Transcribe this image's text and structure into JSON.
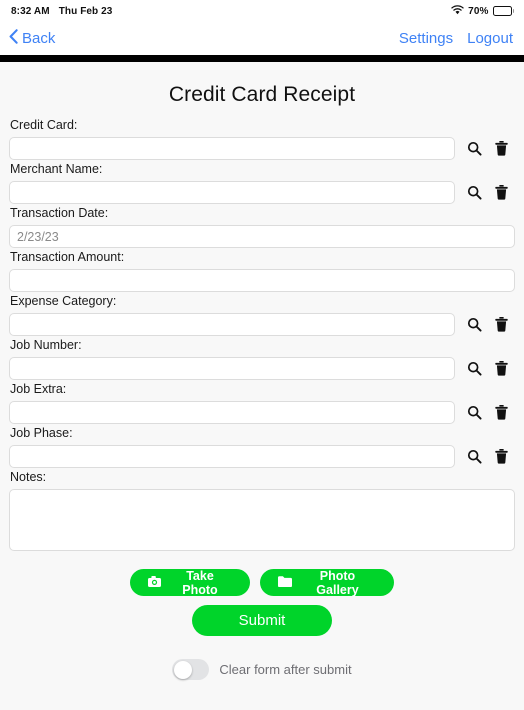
{
  "statusbar": {
    "time": "8:32 AM",
    "date": "Thu Feb 23",
    "battery_percent": "70%",
    "wifi_icon": "wifi-icon",
    "battery_icon": "battery-icon"
  },
  "navbar": {
    "back_label": "Back",
    "back_icon": "chevron-left-icon",
    "settings_label": "Settings",
    "logout_label": "Logout",
    "link_color": "#3f82f5"
  },
  "page": {
    "title": "Credit Card Receipt",
    "background": "#f8f8f8",
    "accent_green": "#00d42a"
  },
  "fields": [
    {
      "label": "Credit Card:",
      "value": "",
      "placeholder": "",
      "has_icons": true,
      "search_icon": "search-icon",
      "trash_icon": "trash-icon"
    },
    {
      "label": "Merchant Name:",
      "value": "",
      "placeholder": "",
      "has_icons": true,
      "search_icon": "search-icon",
      "trash_icon": "trash-icon"
    },
    {
      "label": "Transaction Date:",
      "value": "2/23/23",
      "placeholder": "",
      "has_icons": false
    },
    {
      "label": "Transaction Amount:",
      "value": "",
      "placeholder": "",
      "has_icons": false
    },
    {
      "label": "Expense Category:",
      "value": "",
      "placeholder": "",
      "has_icons": true,
      "search_icon": "search-icon",
      "trash_icon": "trash-icon"
    },
    {
      "label": "Job Number:",
      "value": "",
      "placeholder": "",
      "has_icons": true,
      "search_icon": "search-icon",
      "trash_icon": "trash-icon"
    },
    {
      "label": "Job Extra:",
      "value": "",
      "placeholder": "",
      "has_icons": true,
      "search_icon": "search-icon",
      "trash_icon": "trash-icon"
    },
    {
      "label": "Job Phase:",
      "value": "",
      "placeholder": "",
      "has_icons": true,
      "search_icon": "search-icon",
      "trash_icon": "trash-icon"
    }
  ],
  "notes": {
    "label": "Notes:",
    "value": "",
    "placeholder": ""
  },
  "actions": {
    "take_photo_label": "Take Photo",
    "take_photo_icon": "camera-icon",
    "photo_gallery_label": "Photo Gallery",
    "photo_gallery_icon": "folder-icon",
    "submit_label": "Submit"
  },
  "clear_toggle": {
    "label": "Clear form after submit",
    "state": "off"
  }
}
